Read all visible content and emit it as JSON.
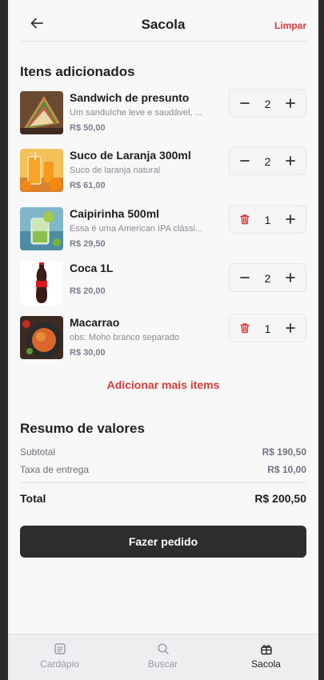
{
  "header": {
    "title": "Sacola",
    "clear_label": "Limpar"
  },
  "items_section": {
    "title": "Itens adicionados"
  },
  "items": [
    {
      "name": "Sandwich de presunto",
      "description": "Um sanduíche leve e saudável, ...",
      "price": "R$ 50,00",
      "quantity": "2",
      "left_action": "minus-icon"
    },
    {
      "name": "Suco de Laranja 300ml",
      "description": "Suco de laranja natural",
      "price": "R$ 61,00",
      "quantity": "2",
      "left_action": "minus-icon"
    },
    {
      "name": "Caipirinha 500ml",
      "description": "Essa é uma American IPA clássi...",
      "price": "R$ 29,50",
      "quantity": "1",
      "left_action": "trash-icon"
    },
    {
      "name": "Coca 1L",
      "description": "",
      "price": "R$ 20,00",
      "quantity": "2",
      "left_action": "minus-icon"
    },
    {
      "name": "Macarrao",
      "description": "obs: Moho branco separado",
      "price": "R$ 30,00",
      "quantity": "1",
      "left_action": "trash-icon"
    }
  ],
  "add_more_label": "Adicionar mais items",
  "summary": {
    "title": "Resumo de valores",
    "subtotal_label": "Subtotal",
    "subtotal_value": "R$ 190,50",
    "delivery_label": "Taxa de entrega",
    "delivery_value": "R$ 10,00",
    "total_label": "Total",
    "total_value": "R$ 200,50"
  },
  "order_button_label": "Fazer pedido",
  "tabbar": [
    {
      "label": "Cardápio",
      "icon": "menu-card-icon",
      "active": false
    },
    {
      "label": "Buscar",
      "icon": "search-icon",
      "active": false
    },
    {
      "label": "Sacola",
      "icon": "bag-icon",
      "active": true
    }
  ],
  "colors": {
    "accent": "#d63b3b",
    "button_dark": "#2d2d2d",
    "background": "#f8f8f9"
  }
}
